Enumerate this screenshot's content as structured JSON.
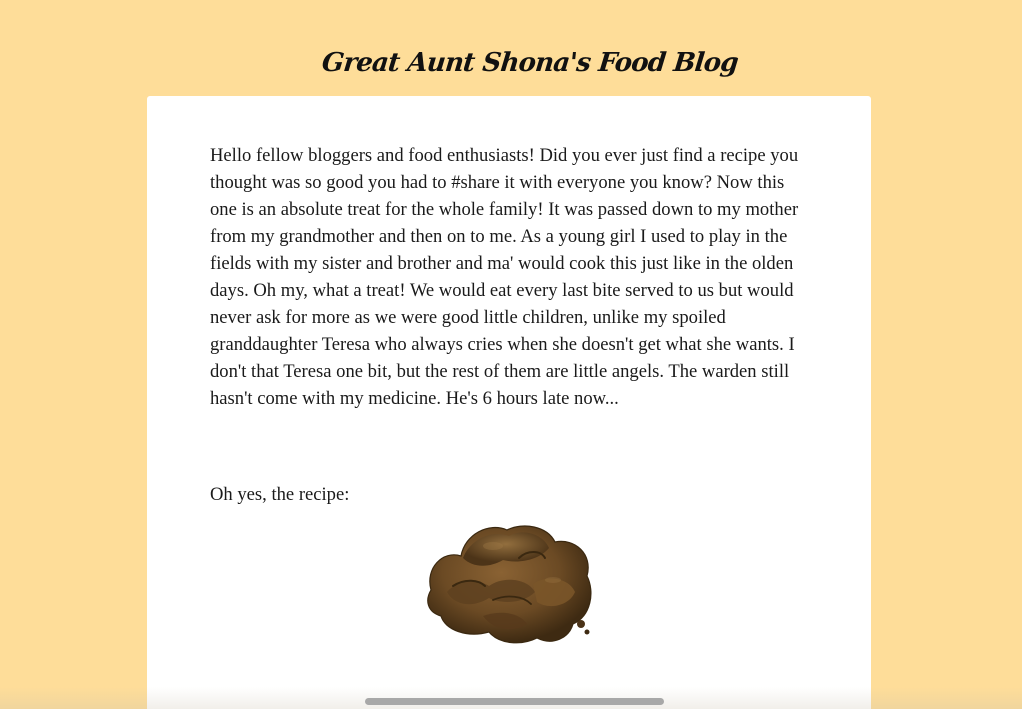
{
  "blog": {
    "title": "Great Aunt Shona's Food Blog"
  },
  "post": {
    "paragraph": "Hello fellow bloggers and food enthusiasts! Did you ever just find a recipe you thought was so good you had to #share it with everyone you know? Now this one is an absolute treat for the whole family! It was passed down to my mother from my grandmother and then on to me. As a young girl I used to play in the fields with my sister and brother and ma' would cook this just like in the olden days. Oh my, what a treat! We would eat every last bite served to us but would never ask for more as we were good little children, unlike my spoiled granddaughter Teresa who always cries when she doesn't get what she wants. I don't that Teresa one bit, but the rest of them are little angels. The warden still hasn't come with my medicine. He's 6 hours late now...",
    "recipe_intro": "Oh yes, the recipe:",
    "image_subject": "brown-lump-photo"
  },
  "colors": {
    "page_background": "#fedd99",
    "card_background": "#ffffff",
    "text": "#1a1a1a",
    "image_brown": "#6b4a24"
  }
}
